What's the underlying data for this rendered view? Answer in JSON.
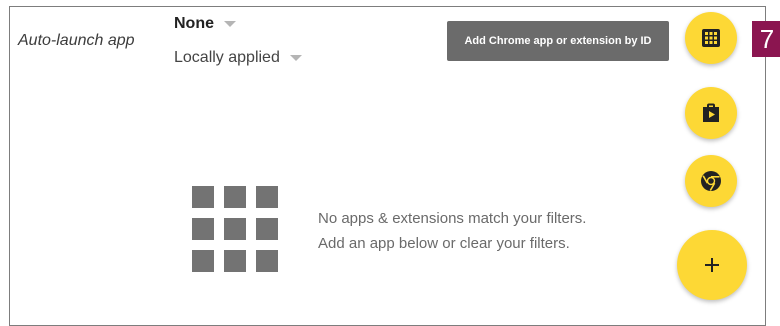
{
  "setting": {
    "label": "Auto-launch app",
    "value": "None",
    "scope": "Locally applied"
  },
  "tooltip": {
    "text": "Add Chrome app or extension by ID"
  },
  "badge": {
    "text": "7"
  },
  "empty_state": {
    "line1": "No apps & extensions match your filters.",
    "line2": "Add an app below or clear your filters."
  },
  "fabs": {
    "add_by_id_icon": "apps-grid-icon",
    "play_store_icon": "shopping-bag-play-icon",
    "chrome_store_icon": "chrome-icon",
    "add_icon": "plus-icon"
  },
  "colors": {
    "fab": "#fdd835",
    "tooltip_bg": "#6b6b6b",
    "badge_bg": "#8b1550"
  }
}
